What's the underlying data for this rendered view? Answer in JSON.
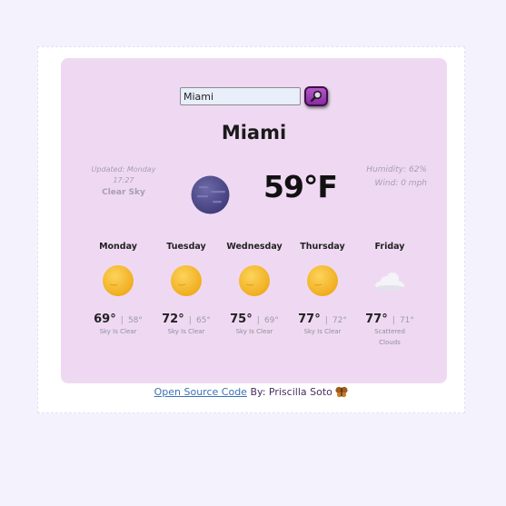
{
  "search": {
    "value": "Miami",
    "button_icon": "magnifier-icon"
  },
  "current": {
    "city": "Miami",
    "updated_label": "Updated: Monday",
    "updated_time": "17:27",
    "description": "Clear Sky",
    "temperature": "59°F",
    "humidity": "Humidity: 62%",
    "wind": "Wind: 0 mph",
    "icon": "clear-night-moon-icon"
  },
  "forecast": [
    {
      "day": "Monday",
      "max": "69°",
      "min": "58°",
      "desc_line1": "Sky Is Clear",
      "desc_line2": "",
      "icon": "sun-icon"
    },
    {
      "day": "Tuesday",
      "max": "72°",
      "min": "65°",
      "desc_line1": "Sky Is Clear",
      "desc_line2": "",
      "icon": "sun-icon"
    },
    {
      "day": "Wednesday",
      "max": "75°",
      "min": "69°",
      "desc_line1": "Sky Is Clear",
      "desc_line2": "",
      "icon": "sun-icon"
    },
    {
      "day": "Thursday",
      "max": "77°",
      "min": "72°",
      "desc_line1": "Sky Is Clear",
      "desc_line2": "",
      "icon": "sun-icon"
    },
    {
      "day": "Friday",
      "max": "77°",
      "min": "71°",
      "desc_line1": "Scattered",
      "desc_line2": "Clouds",
      "icon": "cloud-icon"
    }
  ],
  "footer": {
    "link_text": "Open Source Code",
    "by_text": "By: Priscilla Soto"
  },
  "colors": {
    "card": "#efd9f2",
    "accent": "#9b3bb5",
    "link": "#3e6fb6",
    "sun": "#f4bd2a"
  }
}
